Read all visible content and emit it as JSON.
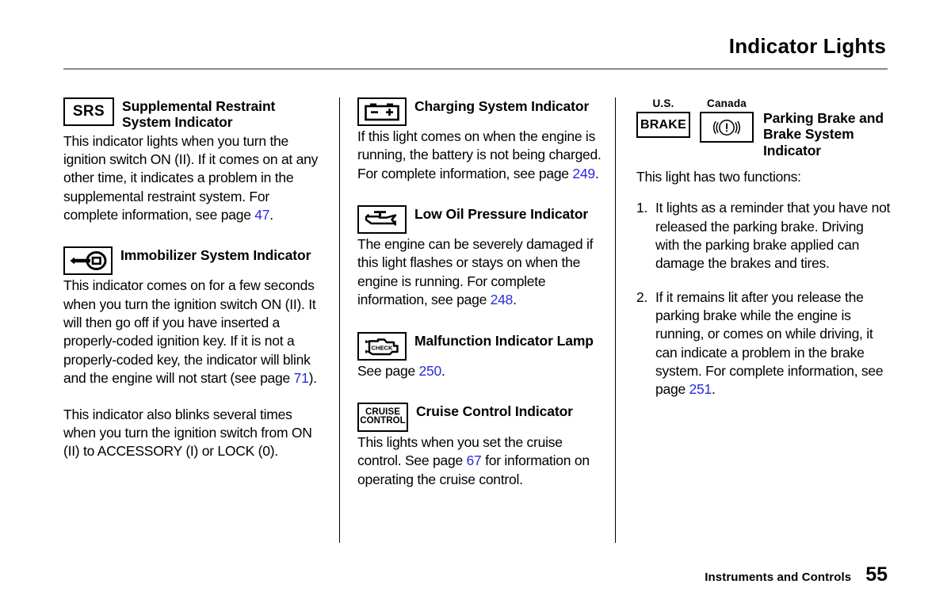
{
  "header": {
    "title": "Indicator Lights"
  },
  "columns": [
    {
      "entries": [
        {
          "icon": "srs-box-icon",
          "icon_text": "SRS",
          "title": "Supplemental Restraint System Indicator",
          "paragraphs": [
            {
              "parts": [
                {
                  "text": "This indicator lights when you turn the ignition switch ON (II). If it comes on at any other time, it indicates a problem in the supplemental restraint system. For complete information, see page "
                },
                {
                  "text": "47",
                  "page_ref": true
                },
                {
                  "text": "."
                }
              ]
            }
          ]
        },
        {
          "icon": "key-immobilizer-icon",
          "title": "Immobilizer System Indicator",
          "paragraphs": [
            {
              "parts": [
                {
                  "text": "This indicator comes on for a few seconds when you turn the ignition switch ON (II). It will then go off if you have inserted a properly-coded ignition key. If it is not a properly-coded key, the indicator will blink and the engine will not start (see page "
                },
                {
                  "text": "71",
                  "page_ref": true
                },
                {
                  "text": ")."
                }
              ]
            },
            {
              "parts": [
                {
                  "text": "This indicator also blinks several times when you turn the ignition switch from ON (II) to ACCESSORY (I) or LOCK (0)."
                }
              ]
            }
          ]
        }
      ]
    },
    {
      "entries": [
        {
          "icon": "battery-icon",
          "title": "Charging System Indicator",
          "paragraphs": [
            {
              "parts": [
                {
                  "text": "If this light comes on when the engine is running, the battery is not being charged. For complete information, see page "
                },
                {
                  "text": "249",
                  "page_ref": true
                },
                {
                  "text": "."
                }
              ]
            }
          ]
        },
        {
          "icon": "oil-can-icon",
          "title": "Low Oil Pressure Indicator",
          "paragraphs": [
            {
              "parts": [
                {
                  "text": "The engine can be severely damaged if this light flashes or stays on when the engine is running. For complete information, see page "
                },
                {
                  "text": "248",
                  "page_ref": true
                },
                {
                  "text": "."
                }
              ]
            }
          ]
        },
        {
          "icon": "check-engine-icon",
          "icon_text": "CHECK",
          "title": "Malfunction Indicator Lamp",
          "paragraphs": [
            {
              "parts": [
                {
                  "text": "See page "
                },
                {
                  "text": "250",
                  "page_ref": true
                },
                {
                  "text": "."
                }
              ]
            }
          ]
        },
        {
          "icon": "cruise-control-icon",
          "icon_text_line1": "CRUISE",
          "icon_text_line2": "CONTROL",
          "title": "Cruise Control Indicator",
          "paragraphs": [
            {
              "parts": [
                {
                  "text": "This lights when you set the cruise control. See page "
                },
                {
                  "text": "67",
                  "page_ref": true
                },
                {
                  "text": " for information on operating the cruise control."
                }
              ]
            }
          ]
        }
      ]
    },
    {
      "brake_entry": {
        "icons": [
          {
            "region_label": "U.S.",
            "icon": "brake-text-icon",
            "icon_text": "BRAKE"
          },
          {
            "region_label": "Canada",
            "icon": "brake-exclamation-icon"
          }
        ],
        "title": "Parking Brake and Brake System Indicator",
        "intro": "This light has two functions:",
        "items": [
          {
            "marker": "1.",
            "text": "It lights as a reminder that you have not released the parking brake. Driving with the parking brake applied can damage the brakes and tires."
          },
          {
            "marker": "2.",
            "parts": [
              {
                "text": "If it remains lit after you release the parking brake while the engine is running, or comes on while driving, it can indicate a problem in the brake system. For complete information, see page "
              },
              {
                "text": "251",
                "page_ref": true
              },
              {
                "text": "."
              }
            ]
          }
        ]
      }
    }
  ],
  "footer": {
    "label": "Instruments and Controls",
    "page_number": "55"
  },
  "colors": {
    "page_reference": "#2a2ae0",
    "rule": "#8a8a8a",
    "text": "#000000"
  }
}
